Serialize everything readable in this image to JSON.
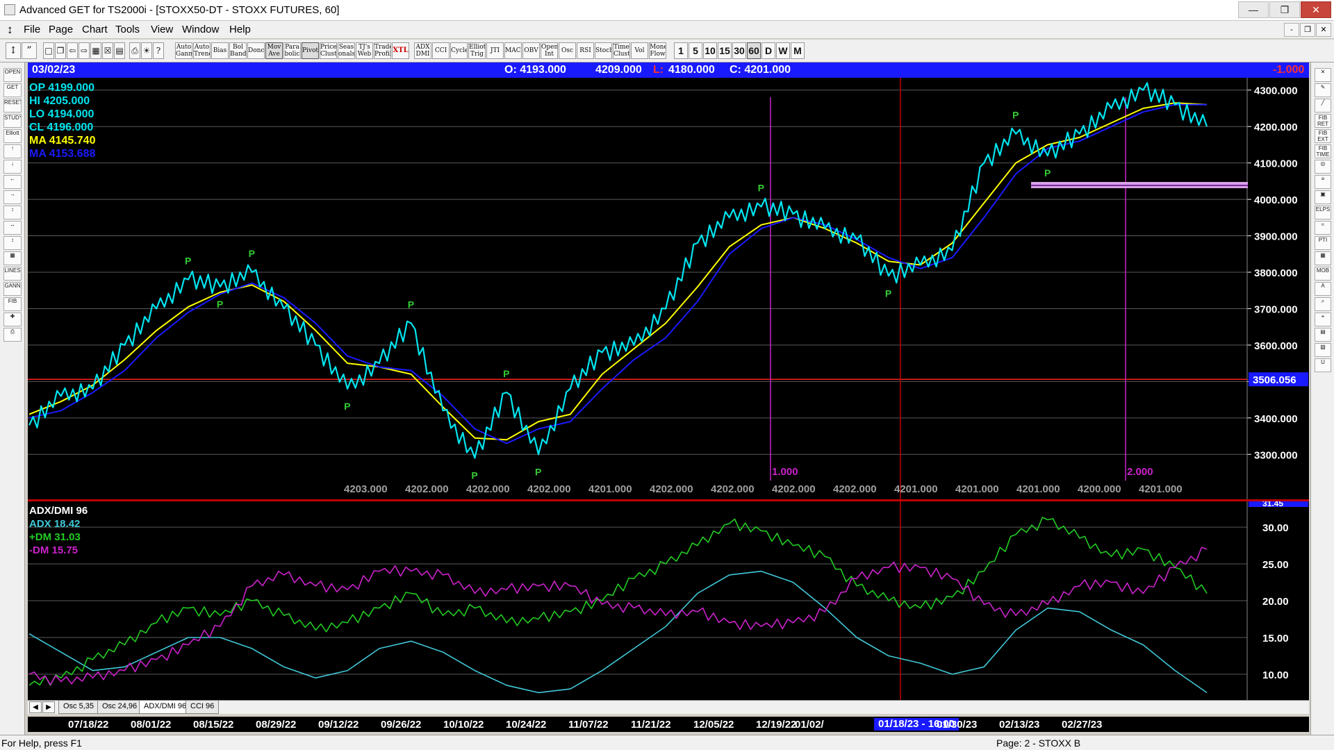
{
  "window": {
    "title": "Advanced GET for TS2000i - [STOXX50-DT - STOXX FUTURES, 60]",
    "minimize": "—",
    "maximize": "❐",
    "close": "✕"
  },
  "menu": {
    "items": [
      "File",
      "Page",
      "Chart",
      "Tools",
      "View",
      "Window",
      "Help"
    ],
    "mdi_minimize": "-",
    "mdi_restore": "❐",
    "mdi_close": "✕"
  },
  "toolbar": {
    "studies": [
      "Auto Gann",
      "Auto Trend",
      "Bias",
      "Bol Band",
      "Donch",
      "Mov Ave",
      "Para bolic",
      "Pivot",
      "Price Clust",
      "Seas onals",
      "TJ's Web",
      "Trade Profile",
      "XTL",
      "ADX DMI",
      "CCI",
      "Cycles",
      "Elliott Trig",
      "JTI",
      "MACD",
      "OBV",
      "Open Int",
      "Osc",
      "RSI",
      "Stoch",
      "Time Clust",
      "Vol",
      "Money Flow"
    ],
    "intervals": [
      "1",
      "5",
      "10",
      "15",
      "30",
      "60",
      "D",
      "W",
      "M"
    ],
    "active_interval": "60"
  },
  "chart_header": {
    "date": "03/02/23",
    "open": "O: 4193.000",
    "high": "4209.000",
    "low_label": "L:",
    "low": "4180.000",
    "close": "C: 4201.000",
    "change": "-1.000"
  },
  "price_readout": {
    "op": "OP  4199.000",
    "hi": "HI   4205.000",
    "lo": "LO  4194.000",
    "cl": "CL  4196.000",
    "ma1": "MA  4145.740",
    "ma2": "MA  4153.688"
  },
  "colors": {
    "price": "#00e5f0",
    "ma_fast": "#ffff00",
    "ma_slow": "#1a1aff",
    "pivot": "#33cc33",
    "adx": "#40c8d8",
    "plus_dm": "#22cc22",
    "minus_dm": "#cc22cc",
    "header": "#1a1aff"
  },
  "chart_data": [
    {
      "type": "line",
      "title": "STOXX50-DT - STOXX FUTURES, 60",
      "ylim": [
        3230,
        4330
      ],
      "y_ticks": [
        "4300.000",
        "4200.000",
        "4100.000",
        "4000.000",
        "3900.000",
        "3800.000",
        "3700.000",
        "3600.000",
        "3500.000",
        "3400.000",
        "3300.000"
      ],
      "last_price_marker": "3506.056",
      "x_dates": [
        "07/18/22",
        "08/01/22",
        "08/15/22",
        "08/29/22",
        "09/12/22",
        "09/26/22",
        "10/10/22",
        "10/24/22",
        "11/07/22",
        "11/21/22",
        "12/05/22",
        "12/19/22",
        "01/02/",
        "01/18/23 - 16:00",
        "01/30/23",
        "02/13/23",
        "02/27/23"
      ],
      "cycle_labels": [
        "4203.000",
        "4202.000",
        "4202.000",
        "4202.000",
        "4201.000",
        "4202.000",
        "4202.000",
        "4202.000",
        "4202.000",
        "4201.000",
        "4201.000",
        "4201.000",
        "4200.000",
        "4201.000",
        "4201.000"
      ],
      "time_markers": [
        "1.000",
        "2.000"
      ],
      "pivot_label": "P",
      "series": [
        {
          "name": "MA 4145.740",
          "values": [
            3410,
            3445,
            3490,
            3560,
            3640,
            3705,
            3745,
            3765,
            3720,
            3640,
            3550,
            3540,
            3520,
            3430,
            3345,
            3340,
            3390,
            3410,
            3520,
            3590,
            3660,
            3760,
            3870,
            3930,
            3950,
            3920,
            3880,
            3830,
            3820,
            3880,
            3990,
            4100,
            4150,
            4170,
            4210,
            4250,
            4265,
            4260
          ]
        },
        {
          "name": "MA 4153.688",
          "values": [
            3400,
            3420,
            3470,
            3530,
            3620,
            3690,
            3740,
            3770,
            3730,
            3660,
            3570,
            3540,
            3530,
            3460,
            3370,
            3330,
            3370,
            3390,
            3480,
            3560,
            3620,
            3720,
            3850,
            3920,
            3950,
            3930,
            3890,
            3840,
            3810,
            3840,
            3950,
            4070,
            4140,
            4160,
            4200,
            4240,
            4260,
            4260
          ]
        },
        {
          "name": "Price",
          "values": [
            3380,
            3460,
            3480,
            3600,
            3700,
            3780,
            3760,
            3800,
            3700,
            3600,
            3480,
            3550,
            3660,
            3420,
            3290,
            3470,
            3300,
            3480,
            3580,
            3600,
            3700,
            3880,
            3950,
            3980,
            3960,
            3920,
            3890,
            3790,
            3820,
            3860,
            4100,
            4180,
            4120,
            4180,
            4250,
            4300,
            4260,
            4200
          ]
        }
      ]
    },
    {
      "type": "line",
      "title": "ADX/DMI 96",
      "ylim": [
        6.5,
        33.5
      ],
      "y_ticks": [
        "30.00",
        "25.00",
        "20.00",
        "15.00",
        "10.00"
      ],
      "top_value": "31.45",
      "legend": [
        "ADX 18.42",
        "+DM 31.03",
        "-DM  15.75"
      ],
      "series": [
        {
          "name": "ADX 18.42",
          "values": [
            15.5,
            13,
            10.5,
            11,
            13,
            15,
            15,
            13.5,
            11,
            9.5,
            10.5,
            13.5,
            14.5,
            13,
            10.5,
            8.5,
            7.5,
            8,
            10.5,
            13.5,
            16.5,
            21,
            23.5,
            24,
            22.5,
            19,
            15,
            12.5,
            11.5,
            10,
            11,
            16,
            19,
            18.5,
            16,
            14,
            10.5,
            7.5
          ]
        },
        {
          "name": "+DM 31.03",
          "values": [
            8.5,
            9.5,
            12,
            14,
            17,
            19,
            18,
            20,
            18,
            16,
            17,
            19,
            21,
            18,
            19,
            17,
            17.5,
            18.5,
            20,
            23,
            25,
            27.5,
            30.5,
            29.5,
            27.5,
            26,
            22,
            20,
            19,
            20.5,
            24,
            29,
            31,
            28.5,
            26,
            27,
            24.5,
            21
          ]
        },
        {
          "name": "-DM  15.75",
          "values": [
            10,
            9,
            9.5,
            10.5,
            12,
            14,
            16.5,
            22,
            23.5,
            22,
            21.5,
            24,
            24,
            23.5,
            21,
            21.5,
            22,
            22,
            19.5,
            19,
            18,
            18.5,
            17,
            16.5,
            17,
            18.5,
            23,
            24.5,
            24.5,
            23,
            19.5,
            18,
            19.5,
            22,
            22.5,
            21,
            24.5,
            27
          ]
        }
      ]
    }
  ],
  "tabs": {
    "prev": "◀",
    "next": "▶",
    "items": [
      "Osc 5,35",
      "Osc 24,96",
      "ADX/DMI 96",
      "CCI 96"
    ],
    "active": "ADX/DMI 96"
  },
  "status": {
    "left": "For Help, press F1",
    "right": "Page: 2 - STOXX B"
  },
  "left_tools": [
    "OPEN",
    "GET",
    "RESET",
    "STUDY",
    "Elliott",
    "↑",
    "↓",
    "←",
    "→",
    "↕",
    "↔",
    "↕",
    "▦",
    "LINES",
    "GANN",
    "FIB",
    "✚",
    "⎙"
  ],
  "right_tools": [
    "✕",
    "✎",
    "╱",
    "FIB RET",
    "FIB EXT",
    "FIB TIME",
    "◎",
    "≡",
    "▣",
    "ELPS",
    "≈",
    "PTI",
    "▦",
    "MOB",
    "A",
    "⌕",
    "⌖",
    "▤",
    "▧",
    "U"
  ]
}
